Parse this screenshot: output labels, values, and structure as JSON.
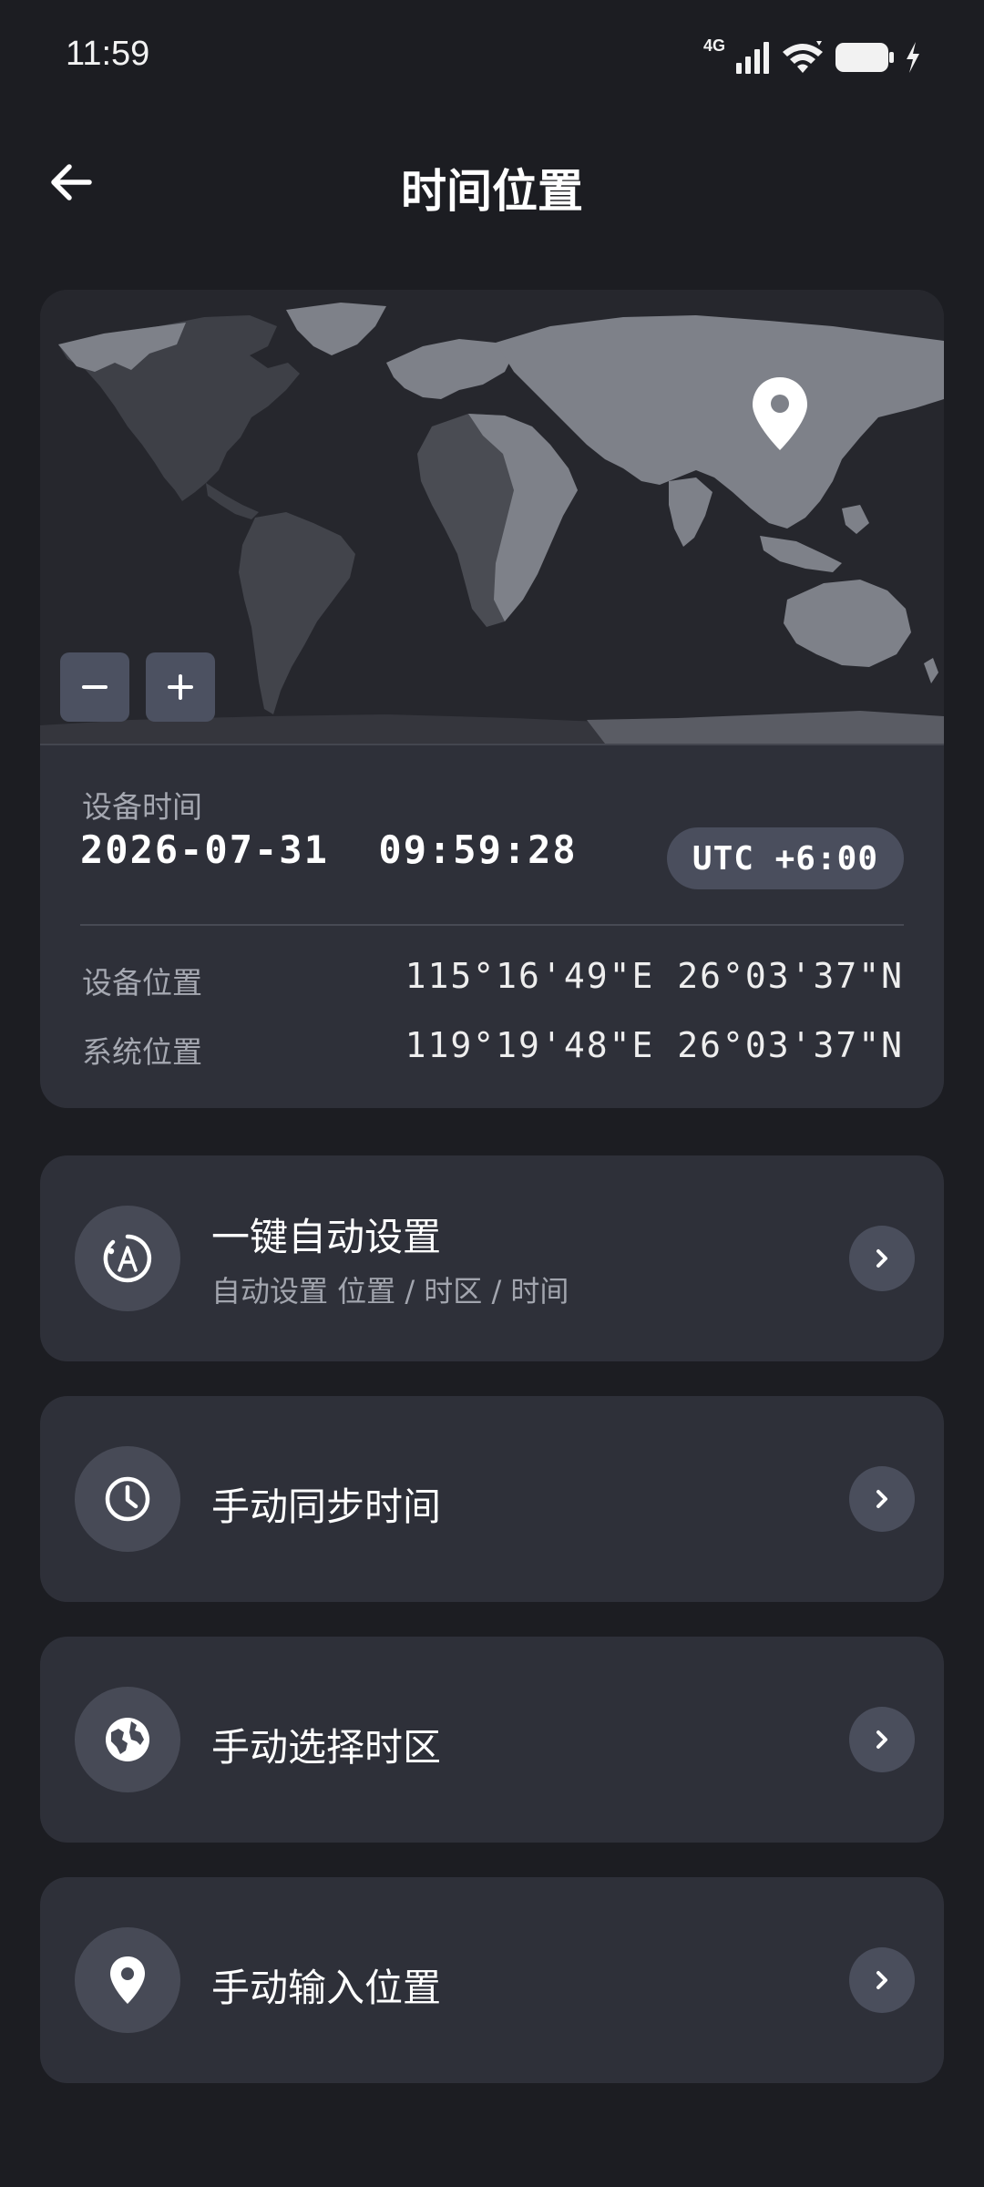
{
  "status_bar": {
    "time": "11:59",
    "network": "4G",
    "icons": [
      "signal-icon",
      "wifi-icon",
      "battery-icon",
      "charging-icon"
    ]
  },
  "header": {
    "title": "时间位置",
    "back_icon": "arrow-left-icon"
  },
  "map": {
    "marker_icon": "location-pin-icon",
    "zoom_out_icon": "minus-icon",
    "zoom_in_icon": "plus-icon"
  },
  "device_time": {
    "label": "设备时间",
    "value": "2026-07-31  09:59:28",
    "timezone": "UTC +6:00"
  },
  "locations": {
    "device_label": "设备位置",
    "device_value": "115°16'49\"E 26°03'37\"N",
    "system_label": "系统位置",
    "system_value": "119°19'48\"E 26°03'37\"N"
  },
  "actions": [
    {
      "title": "一键自动设置",
      "subtitle": "自动设置 位置 / 时区 / 时间",
      "icon": "auto-sync-icon"
    },
    {
      "title": "手动同步时间",
      "subtitle": "",
      "icon": "clock-icon"
    },
    {
      "title": "手动选择时区",
      "subtitle": "",
      "icon": "globe-icon"
    },
    {
      "title": "手动输入位置",
      "subtitle": "",
      "icon": "location-pin-icon"
    }
  ],
  "colors": {
    "background": "#1c1d22",
    "card": "#2e3039",
    "icon_circle": "#474a56",
    "map_land": "#7e8189",
    "map_land_dark": "#3b3d44",
    "map_ocean_night": "#26272d"
  }
}
